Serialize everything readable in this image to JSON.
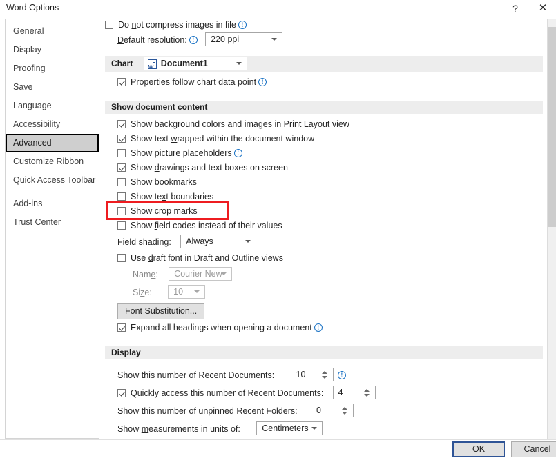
{
  "window": {
    "title": "Word Options",
    "help_icon": "question-mark-icon",
    "close_icon": "close-icon"
  },
  "sidebar": {
    "items": [
      {
        "label": "General",
        "selected": false
      },
      {
        "label": "Display",
        "selected": false
      },
      {
        "label": "Proofing",
        "selected": false
      },
      {
        "label": "Save",
        "selected": false
      },
      {
        "label": "Language",
        "selected": false
      },
      {
        "label": "Accessibility",
        "selected": false
      },
      {
        "label": "Advanced",
        "selected": true
      },
      {
        "label": "Customize Ribbon",
        "selected": false
      },
      {
        "label": "Quick Access Toolbar",
        "selected": false
      },
      {
        "label": "Add-ins",
        "selected": false
      },
      {
        "label": "Trust Center",
        "selected": false
      }
    ]
  },
  "content": {
    "image_size_section": {
      "do_not_compress_label": "Do not compress images in file",
      "do_not_compress_checked": false,
      "default_resolution_label": "Default resolution:",
      "default_resolution_value": "220 ppi"
    },
    "chart_section": {
      "header": "Chart",
      "document_combo_value": "Document1",
      "document_icon": "word-document-icon",
      "properties_follow_label": "Properties follow chart data point",
      "properties_follow_checked": true
    },
    "show_document_content_section": {
      "header": "Show document content",
      "checkboxes": [
        {
          "label": "Show background colors and images in Print Layout view",
          "checked": true,
          "info": false
        },
        {
          "label": "Show text wrapped within the document window",
          "checked": true,
          "info": false
        },
        {
          "label": "Show picture placeholders",
          "checked": false,
          "info": true
        },
        {
          "label": "Show drawings and text boxes on screen",
          "checked": true,
          "info": false
        },
        {
          "label": "Show bookmarks",
          "checked": false,
          "info": false
        },
        {
          "label": "Show text boundaries",
          "checked": false,
          "info": false,
          "highlighted": true
        },
        {
          "label": "Show crop marks",
          "checked": false,
          "info": false
        },
        {
          "label": "Show field codes instead of their values",
          "checked": false,
          "info": false
        }
      ],
      "field_shading_label": "Field shading:",
      "field_shading_value": "Always",
      "use_draft_font_label": "Use draft font in Draft and Outline views",
      "use_draft_font_checked": false,
      "font_name_label": "Name:",
      "font_name_value": "Courier New",
      "font_size_label": "Size:",
      "font_size_value": "10",
      "font_substitution_button": "Font Substitution...",
      "expand_headings_label": "Expand all headings when opening a document",
      "expand_headings_checked": true
    },
    "display_section": {
      "header": "Display",
      "recent_documents_label": "Show this number of Recent Documents:",
      "recent_documents_value": "10",
      "quick_access_label": "Quickly access this number of Recent Documents:",
      "quick_access_value": "4",
      "quick_access_checked": true,
      "unpinned_folders_label": "Show this number of unpinned Recent Folders:",
      "unpinned_folders_value": "0",
      "measurement_units_label": "Show measurements in units of:",
      "measurement_units_value": "Centimeters"
    }
  },
  "footer": {
    "ok_label": "OK",
    "cancel_label": "Cancel"
  },
  "colors": {
    "annotation": "#ee1c20",
    "info_icon": "#1a72c4",
    "selected_item_bg": "#cfcfcf",
    "section_header_bg": "#ededed",
    "ok_focus_border": "#2f5496"
  }
}
